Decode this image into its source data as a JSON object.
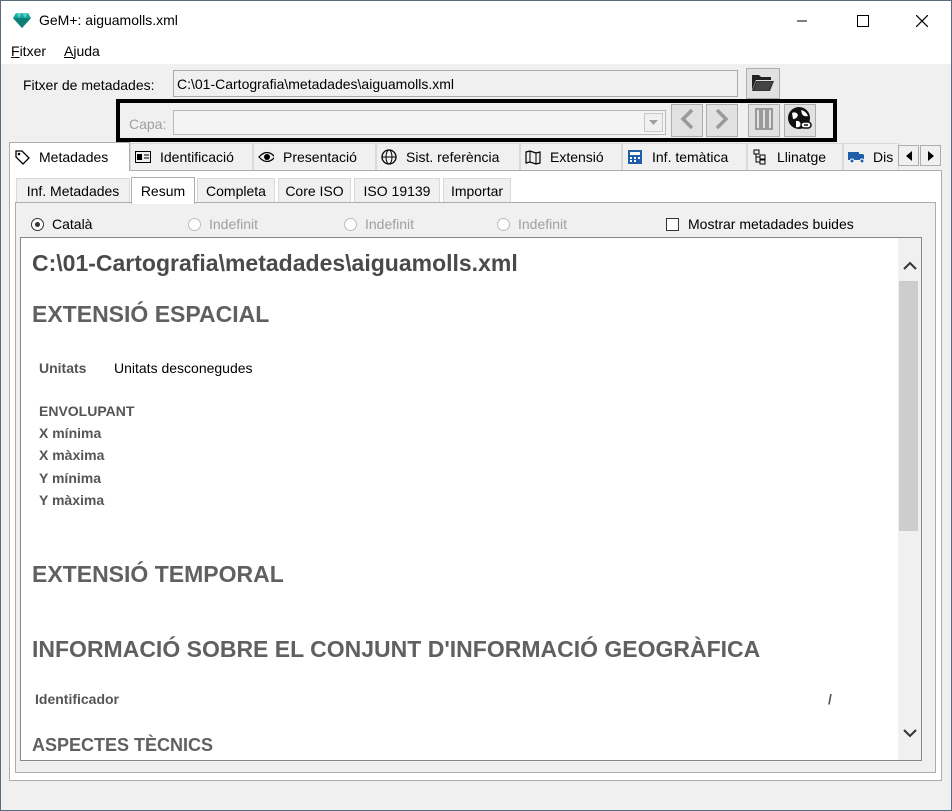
{
  "window": {
    "title": "GeM+: aiguamolls.xml"
  },
  "menu": [
    {
      "accel": "F",
      "rest": "itxer"
    },
    {
      "accel": "A",
      "rest": "juda"
    }
  ],
  "file": {
    "label": "Fitxer de metadades:",
    "value": "C:\\01-Cartografia\\metadades\\aiguamolls.xml"
  },
  "layer": {
    "label": "Capa:",
    "value": ""
  },
  "tabs": [
    {
      "label": "Metadades",
      "icon": "tag-icon"
    },
    {
      "label": "Identificació",
      "icon": "id-card-icon"
    },
    {
      "label": "Presentació",
      "icon": "eye-icon"
    },
    {
      "label": "Sist. referència",
      "icon": "globe-icon"
    },
    {
      "label": "Extensió",
      "icon": "map-icon"
    },
    {
      "label": "Inf. temàtica",
      "icon": "calculator-icon"
    },
    {
      "label": "Llinatge",
      "icon": "tree-icon"
    },
    {
      "label": "Dis",
      "icon": "truck-icon"
    }
  ],
  "subtabs": [
    "Inf. Metadades",
    "Resum",
    "Completa",
    "Core ISO",
    "ISO 19139",
    "Importar"
  ],
  "languages": [
    "Català",
    "Indefinit",
    "Indefinit",
    "Indefinit"
  ],
  "show_empty_label": "Mostrar metadades buides",
  "summary": {
    "file_path": "C:\\01-Cartografia\\metadades\\aiguamolls.xml",
    "spatial_heading": "EXTENSIÓ ESPACIAL",
    "units_label": "Unitats",
    "units_value": "Unitats desconegudes",
    "envelope_label": "ENVOLUPANT",
    "xmin_label": "X mínima",
    "xmax_label": "X màxima",
    "ymin_label": "Y mínima",
    "ymax_label": "Y màxima",
    "temporal_heading": "EXTENSIÓ TEMPORAL",
    "dataset_heading": "INFORMACIÓ SOBRE EL CONJUNT D'INFORMACIÓ GEOGRÀFICA",
    "identifier_label": "Identificador",
    "identifier_value": "/",
    "technical_heading": "ASPECTES TÈCNICS"
  },
  "colors": {
    "accent": "#0078d7",
    "heading": "#606060",
    "disabled": "#a0a0a0"
  }
}
